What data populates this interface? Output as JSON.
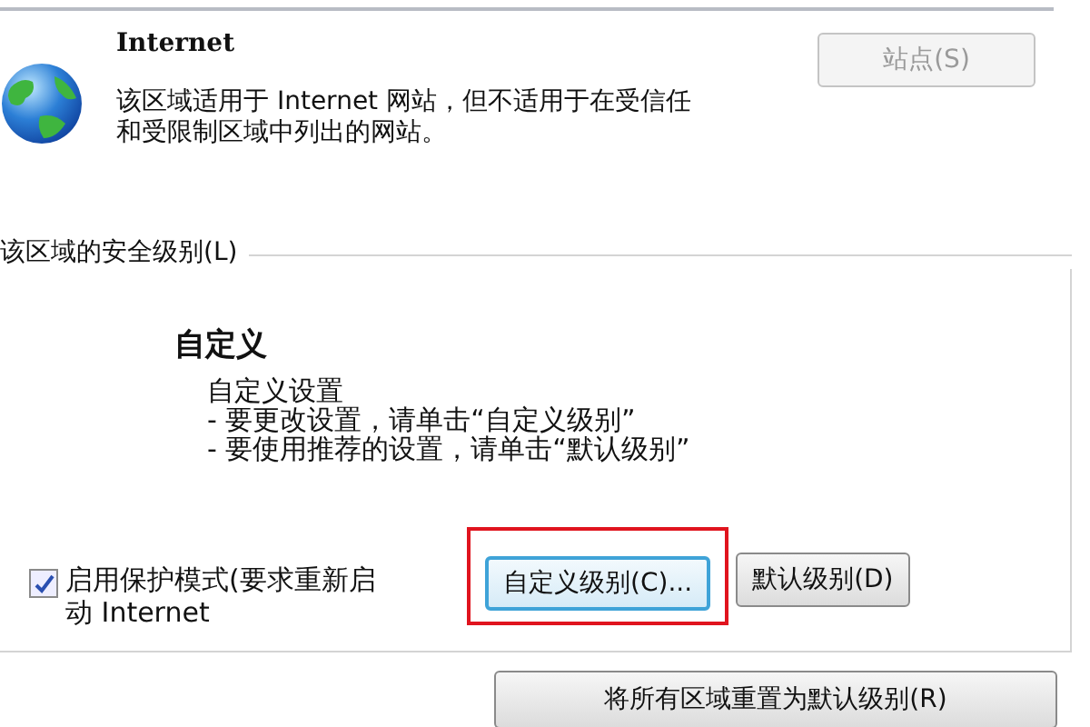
{
  "zone": {
    "name": "Internet",
    "description": "该区域适用于 Internet 网站，但不适用于在受信任和受限制区域中列出的网站。",
    "sites_button": {
      "label": "站点(S)",
      "disabled": true
    }
  },
  "security_level": {
    "group_label": "该区域的安全级别(L)",
    "level_name": "自定义",
    "details": [
      "自定义设置",
      "- 要更改设置，请单击“自定义级别”",
      "- 要使用推荐的设置，请单击“默认级别”"
    ],
    "protected_mode": {
      "label": "启用保护模式(要求重新启动 Internet",
      "checked": true
    },
    "buttons": [
      {
        "label": "自定义级别(C)...",
        "focused": true,
        "highlighted": true
      },
      {
        "label": "默认级别(D)",
        "focused": false,
        "highlighted": false
      }
    ]
  },
  "reset_button": {
    "label": "将所有区域重置为默认级别(R)"
  }
}
